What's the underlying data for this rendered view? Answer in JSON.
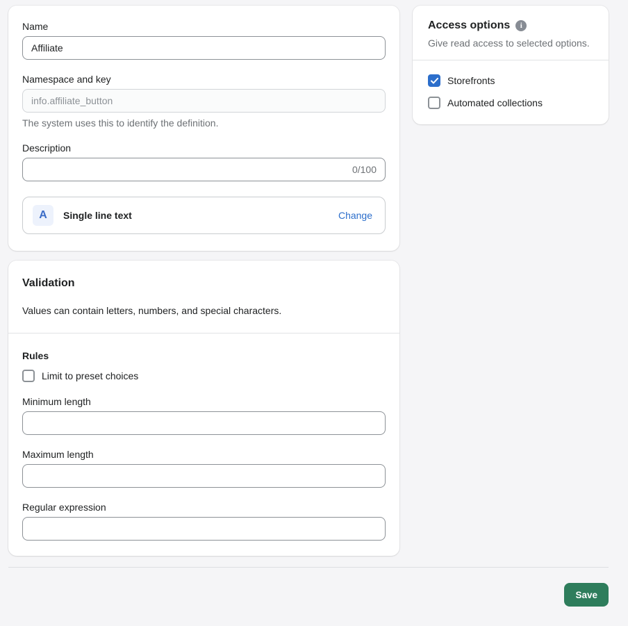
{
  "colors": {
    "accent_blue": "#2c6ecb",
    "type_icon_blue": "#3b6cc7",
    "save_green": "#2e7d5c",
    "page_background": "#f5f5f7"
  },
  "icons": {
    "info": "i",
    "single_line_text": "A",
    "checkmark": "check"
  },
  "definition_card": {
    "name_label": "Name",
    "name_value": "Affiliate",
    "namespace_label": "Namespace and key",
    "namespace_value": "info.affiliate_button",
    "namespace_help": "The system uses this to identify the definition.",
    "description_label": "Description",
    "description_value": "",
    "description_counter": "0/100",
    "type": {
      "icon_letter": "A",
      "label": "Single line text",
      "change_label": "Change"
    }
  },
  "validation_card": {
    "title": "Validation",
    "subtitle": "Values can contain letters, numbers, and special characters.",
    "rules_label": "Rules",
    "preset_checkbox_label": "Limit to preset choices",
    "preset_checked": false,
    "fields": [
      {
        "label": "Minimum length",
        "value": ""
      },
      {
        "label": "Maximum length",
        "value": ""
      },
      {
        "label": "Regular expression",
        "value": ""
      }
    ]
  },
  "access_card": {
    "title": "Access options",
    "subtitle": "Give read access to selected options.",
    "options": [
      {
        "label": "Storefronts",
        "checked": true
      },
      {
        "label": "Automated collections",
        "checked": false
      }
    ]
  },
  "footer": {
    "save_label": "Save"
  }
}
